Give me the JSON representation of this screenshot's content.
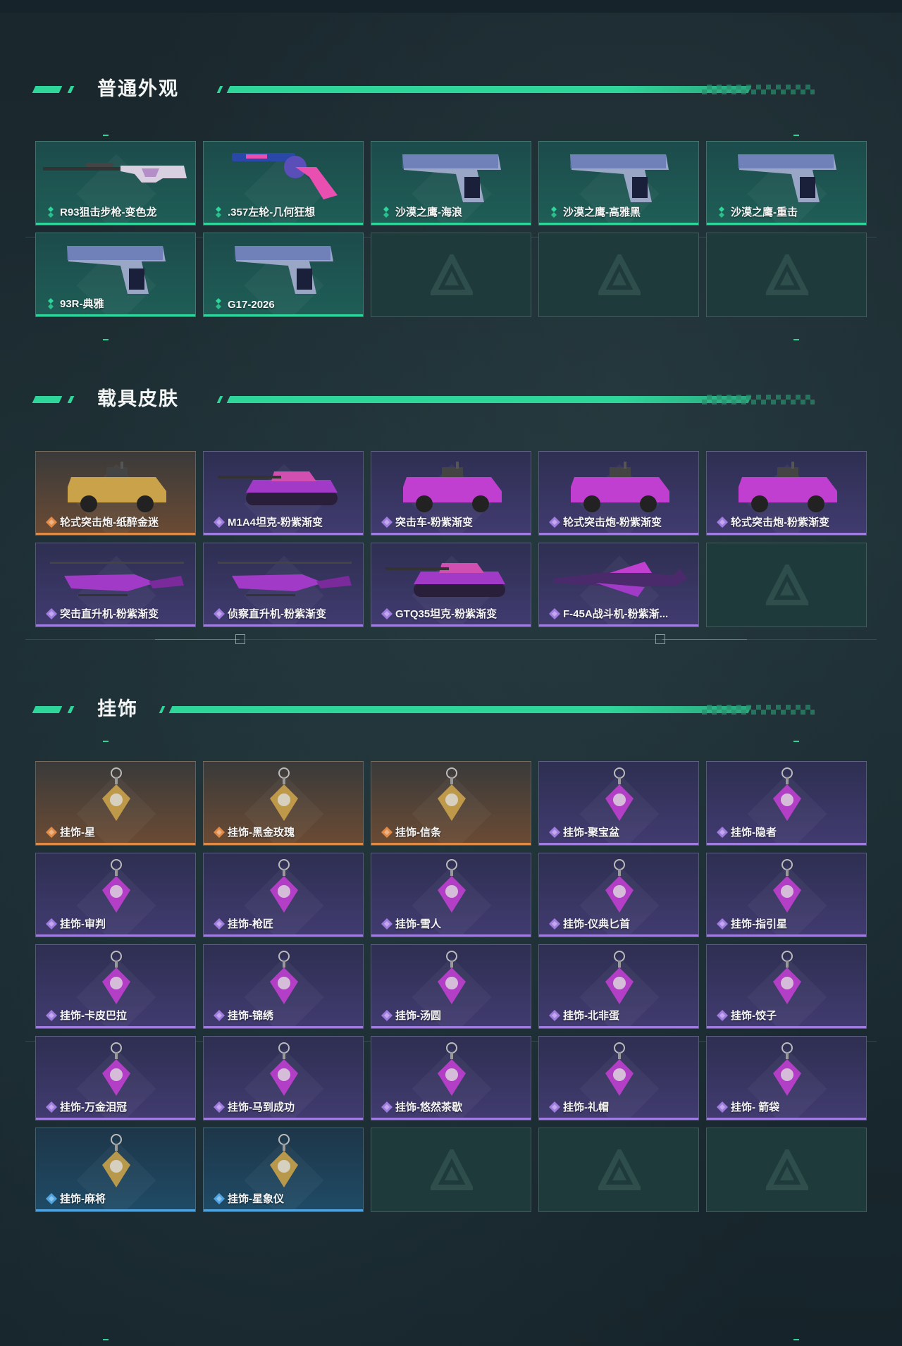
{
  "sections": [
    {
      "title": "普通外观",
      "items": [
        {
          "name": "R93狙击步枪-变色龙",
          "rarity": "green",
          "icon": "sniper-rifle-icon"
        },
        {
          "name": ".357左轮-几何狂想",
          "rarity": "green",
          "icon": "revolver-icon"
        },
        {
          "name": "沙漠之鹰-海浪",
          "rarity": "green",
          "icon": "pistol-icon"
        },
        {
          "name": "沙漠之鹰-高雅黑",
          "rarity": "green",
          "icon": "pistol-icon"
        },
        {
          "name": "沙漠之鹰-重击",
          "rarity": "green",
          "icon": "pistol-icon"
        },
        {
          "name": "93R-典雅",
          "rarity": "green",
          "icon": "pistol-icon"
        },
        {
          "name": "G17-2026",
          "rarity": "green",
          "icon": "pistol-icon"
        }
      ]
    },
    {
      "title": "载具皮肤",
      "items": [
        {
          "name": "轮式突击炮-纸醉金迷",
          "rarity": "orange",
          "icon": "armored-car-icon"
        },
        {
          "name": "M1A4坦克-粉紫渐变",
          "rarity": "purple",
          "icon": "tank-icon"
        },
        {
          "name": "突击车-粉紫渐变",
          "rarity": "purple",
          "icon": "armored-car-icon"
        },
        {
          "name": "轮式突击炮-粉紫渐变",
          "rarity": "purple",
          "icon": "armored-car-icon"
        },
        {
          "name": "轮式突击炮-粉紫渐变",
          "rarity": "purple",
          "icon": "armored-car-icon"
        },
        {
          "name": "突击直升机-粉紫渐变",
          "rarity": "purple",
          "icon": "helicopter-icon"
        },
        {
          "name": "侦察直升机-粉紫渐变",
          "rarity": "purple",
          "icon": "helicopter-icon"
        },
        {
          "name": "GTQ35坦克-粉紫渐变",
          "rarity": "purple",
          "icon": "tank-icon"
        },
        {
          "name": "F-45A战斗机-粉紫渐...",
          "rarity": "purple",
          "icon": "jet-icon"
        }
      ]
    },
    {
      "title": "挂饰",
      "items": [
        {
          "name": "挂饰-星",
          "rarity": "orange",
          "icon": "charm-icon"
        },
        {
          "name": "挂饰-黑金玫瑰",
          "rarity": "orange",
          "icon": "charm-icon"
        },
        {
          "name": "挂饰-信条",
          "rarity": "orange",
          "icon": "charm-icon"
        },
        {
          "name": "挂饰-聚宝盆",
          "rarity": "purple",
          "icon": "charm-icon"
        },
        {
          "name": "挂饰-隐者",
          "rarity": "purple",
          "icon": "charm-icon"
        },
        {
          "name": "挂饰-审判",
          "rarity": "purple",
          "icon": "charm-icon"
        },
        {
          "name": "挂饰-枪匠",
          "rarity": "purple",
          "icon": "charm-icon"
        },
        {
          "name": "挂饰-雪人",
          "rarity": "purple",
          "icon": "charm-icon"
        },
        {
          "name": "挂饰-仪典匕首",
          "rarity": "purple",
          "icon": "charm-icon"
        },
        {
          "name": "挂饰-指引星",
          "rarity": "purple",
          "icon": "charm-icon"
        },
        {
          "name": "挂饰-卡皮巴拉",
          "rarity": "purple",
          "icon": "charm-icon"
        },
        {
          "name": "挂饰-锦绣",
          "rarity": "purple",
          "icon": "charm-icon"
        },
        {
          "name": "挂饰-汤圆",
          "rarity": "purple",
          "icon": "charm-icon"
        },
        {
          "name": "挂饰-北非蛋",
          "rarity": "purple",
          "icon": "charm-icon"
        },
        {
          "name": "挂饰-饺子",
          "rarity": "purple",
          "icon": "charm-icon"
        },
        {
          "name": "挂饰-万金泪冠",
          "rarity": "purple",
          "icon": "charm-icon"
        },
        {
          "name": "挂饰-马到成功",
          "rarity": "purple",
          "icon": "charm-icon"
        },
        {
          "name": "挂饰-悠然茶歇",
          "rarity": "purple",
          "icon": "charm-icon"
        },
        {
          "name": "挂饰-礼帽",
          "rarity": "purple",
          "icon": "charm-icon"
        },
        {
          "name": "挂饰- 箭袋",
          "rarity": "purple",
          "icon": "charm-icon"
        },
        {
          "name": "挂饰-麻将",
          "rarity": "blue",
          "icon": "charm-icon"
        },
        {
          "name": "挂饰-星象仪",
          "rarity": "blue",
          "icon": "charm-icon"
        }
      ]
    }
  ],
  "colors": {
    "accent": "#2fd69a",
    "green": "#2fd69a",
    "purple": "#a07be0",
    "orange": "#e08a45",
    "blue": "#4fa3e0"
  }
}
